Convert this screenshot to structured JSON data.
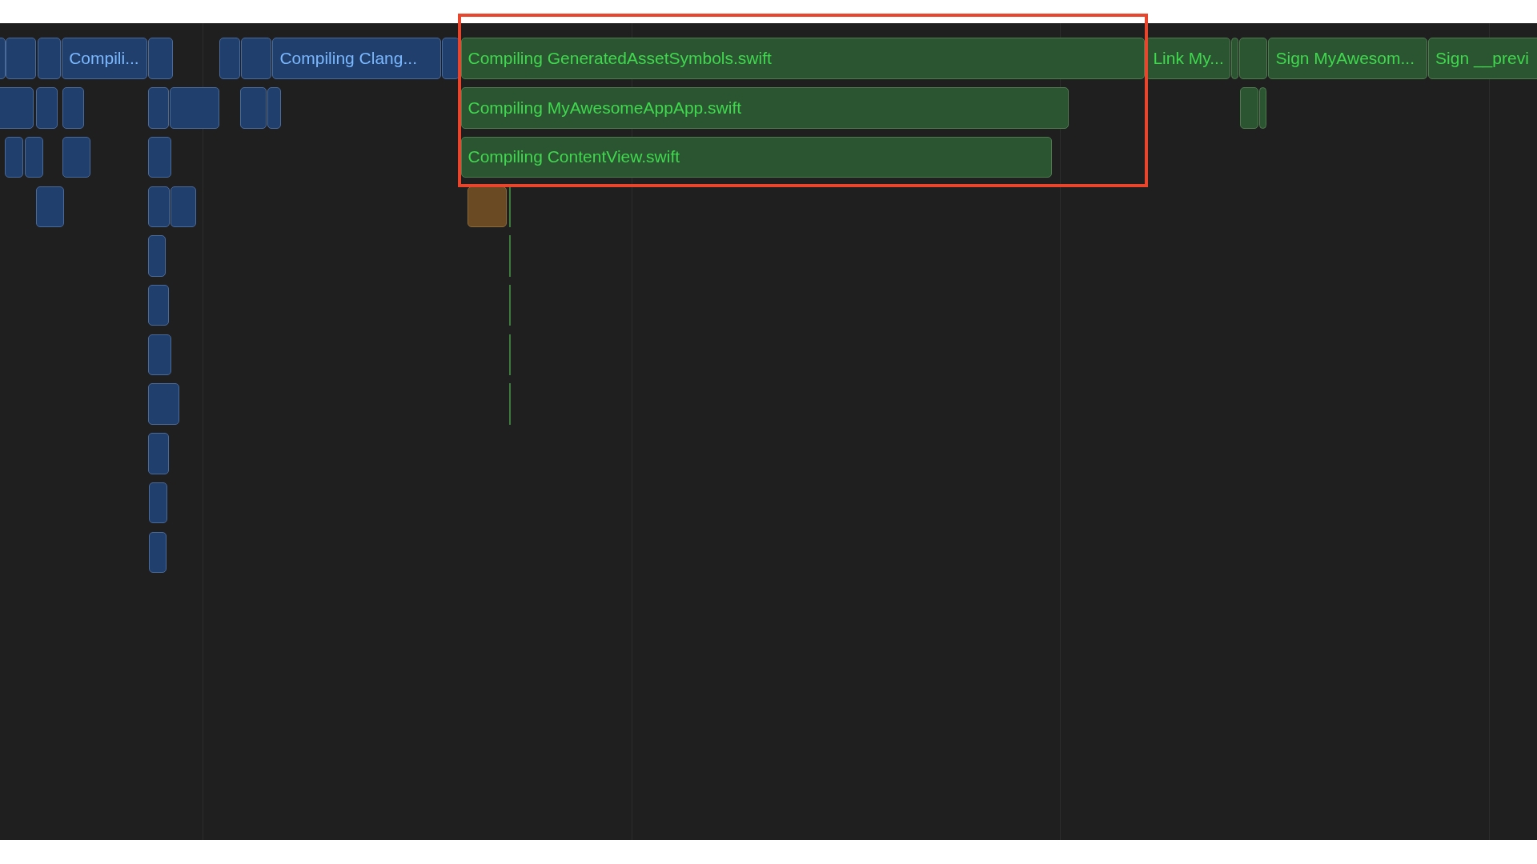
{
  "timeline": {
    "tasks": [
      {
        "label": "Compili...",
        "color": "#213f6d"
      },
      {
        "label": "Compiling Clang...",
        "color": "#213f6d"
      },
      {
        "label": "Compiling GeneratedAssetSymbols.swift",
        "color": "#2b5530"
      },
      {
        "label": "Link My...",
        "color": "#2b5530"
      },
      {
        "label": "Sign MyAwesom...",
        "color": "#2b5530"
      },
      {
        "label": "Sign __previ",
        "color": "#2b5530"
      },
      {
        "label": "Compiling MyAwesomeAppApp.swift",
        "color": "#2b5530"
      },
      {
        "label": "Compiling ContentView.swift",
        "color": "#2b5530"
      }
    ]
  }
}
